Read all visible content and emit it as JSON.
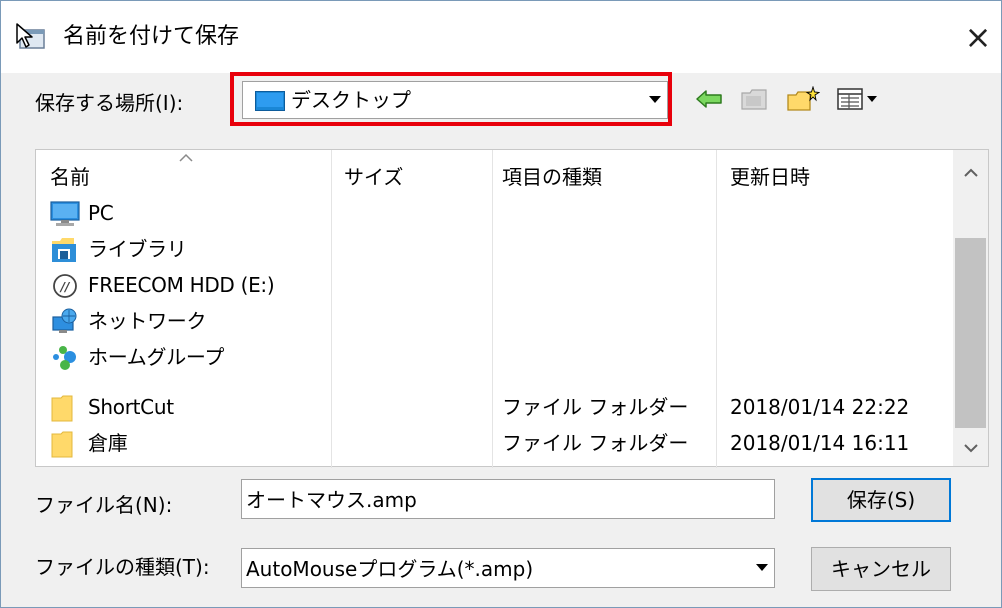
{
  "window": {
    "title": "名前を付けて保存",
    "close_label": "×"
  },
  "location": {
    "label": "保存する場所(I):",
    "value": "デスクトップ"
  },
  "columns": {
    "name": "名前",
    "size": "サイズ",
    "type": "項目の種類",
    "modified": "更新日時"
  },
  "files": [
    {
      "name": "PC",
      "type": "",
      "modified": "",
      "icon": "pc-icon"
    },
    {
      "name": "ライブラリ",
      "type": "",
      "modified": "",
      "icon": "library-icon"
    },
    {
      "name": "FREECOM HDD (E:)",
      "type": "",
      "modified": "",
      "icon": "drive-icon"
    },
    {
      "name": "ネットワーク",
      "type": "",
      "modified": "",
      "icon": "network-icon"
    },
    {
      "name": "ホームグループ",
      "type": "",
      "modified": "",
      "icon": "homegroup-icon"
    },
    {
      "name": "ShortCut",
      "type": "ファイル フォルダー",
      "modified": "2018/01/14 22:22",
      "icon": "folder-icon"
    },
    {
      "name": "倉庫",
      "type": "ファイル フォルダー",
      "modified": "2018/01/14 16:11",
      "icon": "folder-icon"
    }
  ],
  "filename": {
    "label": "ファイル名(N):",
    "value": "オートマウス.amp"
  },
  "filetype": {
    "label": "ファイルの種類(T):",
    "value": "AutoMouseプログラム(*.amp)"
  },
  "buttons": {
    "save": "保存(S)",
    "cancel": "キャンセル"
  },
  "colors": {
    "highlight": "#e8000b",
    "accent": "#0078d7",
    "folder": "#ffd96a",
    "background": "#f0f0f0"
  }
}
